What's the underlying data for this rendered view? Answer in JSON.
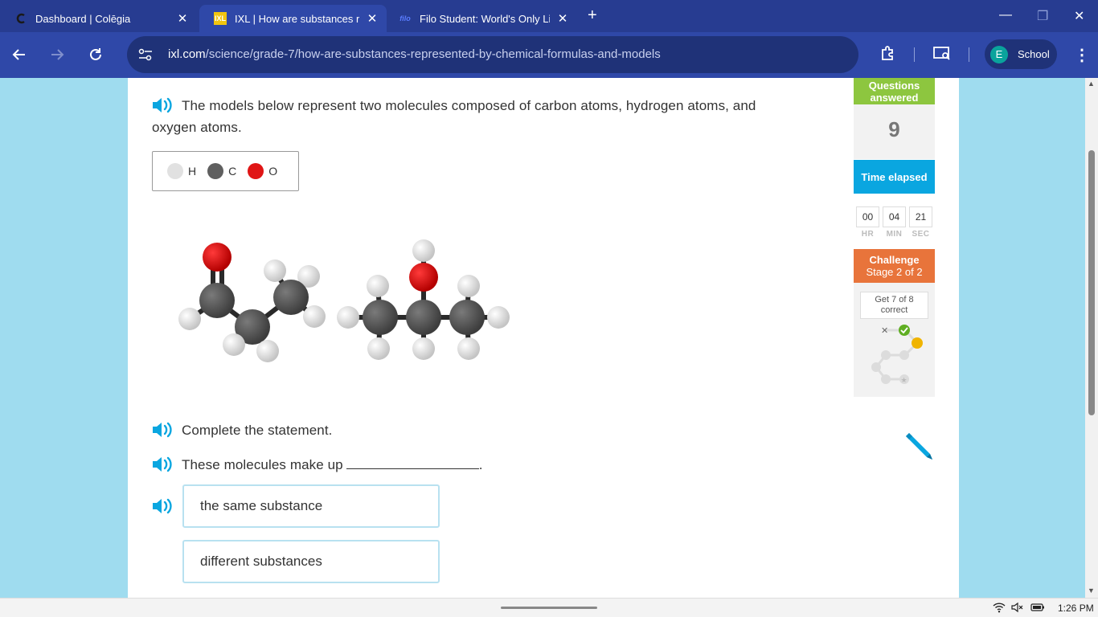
{
  "browser": {
    "tabs": [
      {
        "title": "Dashboard | Colēgia",
        "active": false
      },
      {
        "title": "IXL | How are substances rep",
        "active": true
      },
      {
        "title": "Filo Student: World's Only Li",
        "active": false
      }
    ],
    "url_host": "ixl.com",
    "url_path": "/science/grade-7/how-are-substances-represented-by-chemical-formulas-and-models",
    "profile_initial": "E",
    "profile_name": "School"
  },
  "question": {
    "intro": "The models below represent two molecules composed of carbon atoms, hydrogen atoms, and oxygen atoms.",
    "legend": [
      {
        "symbol": "H",
        "color": "#e1e1e1"
      },
      {
        "symbol": "C",
        "color": "#5f5f5f"
      },
      {
        "symbol": "O",
        "color": "#e01515"
      }
    ],
    "instruction": "Complete the statement.",
    "statement": "These molecules make up",
    "statement_end": ".",
    "choices": [
      {
        "label": "the same substance"
      },
      {
        "label": "different substances"
      }
    ]
  },
  "sidebar": {
    "questions_answered_label": "Questions answered",
    "questions_answered": "9",
    "time_elapsed_label": "Time elapsed",
    "time": {
      "hr": "00",
      "min": "04",
      "sec": "21"
    },
    "time_units": {
      "hr": "HR",
      "min": "MIN",
      "sec": "SEC"
    },
    "challenge_label": "Challenge",
    "challenge_stage": "Stage 2 of 2",
    "goal": "Get 7 of 8 correct"
  },
  "system": {
    "time": "1:26 PM"
  },
  "colors": {
    "ixl_green": "#8dc63f",
    "ixl_blue": "#0aa6e0",
    "ixl_orange": "#e8743b",
    "chrome_dark": "#273c91",
    "chrome_toolbar": "#2f48a8"
  }
}
